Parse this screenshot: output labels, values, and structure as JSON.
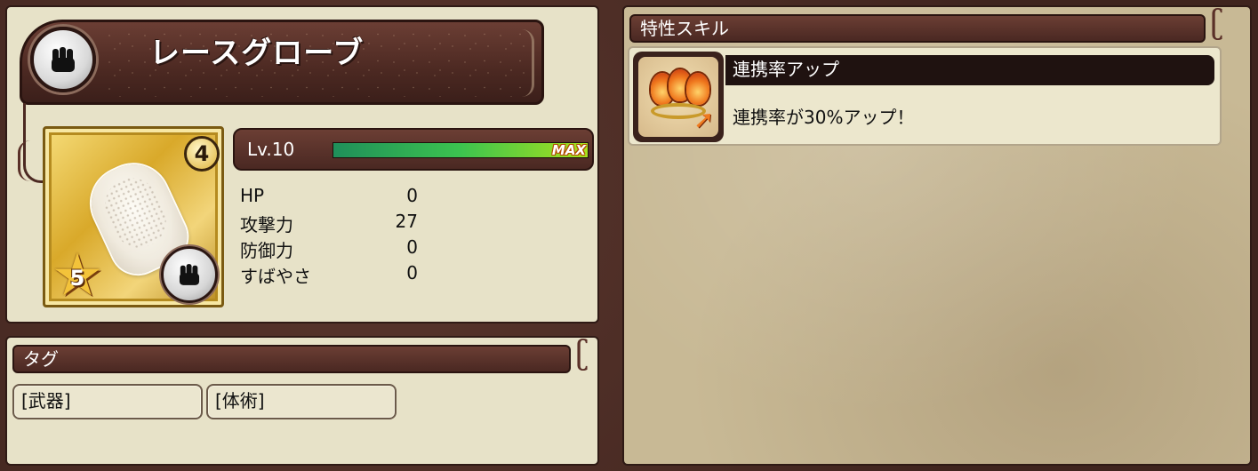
{
  "item": {
    "name": "レースグローブ",
    "type_icon": "fist-icon",
    "rank": "4",
    "stars": "5",
    "level_label": "Lv.10",
    "exp_progress": 1.0,
    "exp_max_label": "MAX",
    "stats": [
      {
        "label": "HP",
        "value": "0"
      },
      {
        "label": "攻撃力",
        "value": "27"
      },
      {
        "label": "防御力",
        "value": "0"
      },
      {
        "label": "すばやさ",
        "value": "0"
      }
    ]
  },
  "tags": {
    "header": "タグ",
    "items": [
      "[武器]",
      "[体術]"
    ]
  },
  "skills": {
    "header": "特性スキル",
    "items": [
      {
        "name": "連携率アップ",
        "description": "連携率が30%アップ！",
        "icon": "chain-rate-up-icon"
      }
    ]
  },
  "colors": {
    "panel_bg": "#e7e2c8",
    "header_brown": "#4a2822",
    "exp_green": "#3cc34f",
    "gold_card": "#d9a92a"
  }
}
